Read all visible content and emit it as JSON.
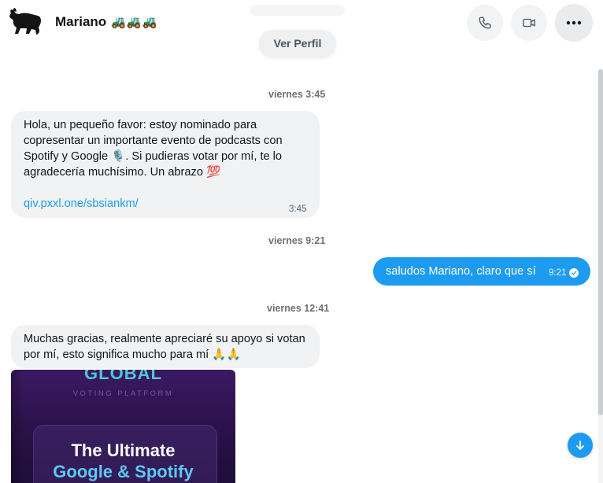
{
  "header": {
    "contact_name": "Mariano",
    "name_emoji": "🚜🚜🚜",
    "avatar_icon": "bull-icon",
    "call_icon": "phone-icon",
    "video_icon": "video-camera-icon",
    "more_icon": "more-horizontal-icon",
    "view_profile_label": "Ver Perfil"
  },
  "conversation": [
    {
      "type": "day_stamp",
      "text": "viernes 3:45"
    },
    {
      "type": "incoming",
      "text": "Hola, un pequeño favor: estoy nominado para copresentar un importante evento de podcasts con Spotify y Google 🎙️. Si pudieras votar por mí, te lo agradecería muchísimo. Un abrazo 💯",
      "link": "qiv.pxxl.one/sbsiankm/",
      "time": "3:45"
    },
    {
      "type": "day_stamp",
      "text": "viernes 9:21"
    },
    {
      "type": "outgoing",
      "text": "saludos Mariano, claro que sí",
      "time": "9:21",
      "status_icon": "check-circle-icon"
    },
    {
      "type": "day_stamp",
      "text": "viernes 12:41"
    },
    {
      "type": "incoming",
      "text": "Muchas gracias, realmente apreciaré su apoyo si votan por mí, esto significa mucho para mí 🙏🙏"
    }
  ],
  "media_card": {
    "heading": "GLOBAL",
    "subheading": "VOTING PLATFORM",
    "line1": "The Ultimate",
    "line2": "Google & Spotify"
  },
  "scroll_down_icon": "arrow-down-icon",
  "colors": {
    "accent": "#1d9bf0",
    "incoming_bubble": "#f0f2f4",
    "outgoing_bubble": "#1d9bf0",
    "muted_text": "#536471"
  }
}
